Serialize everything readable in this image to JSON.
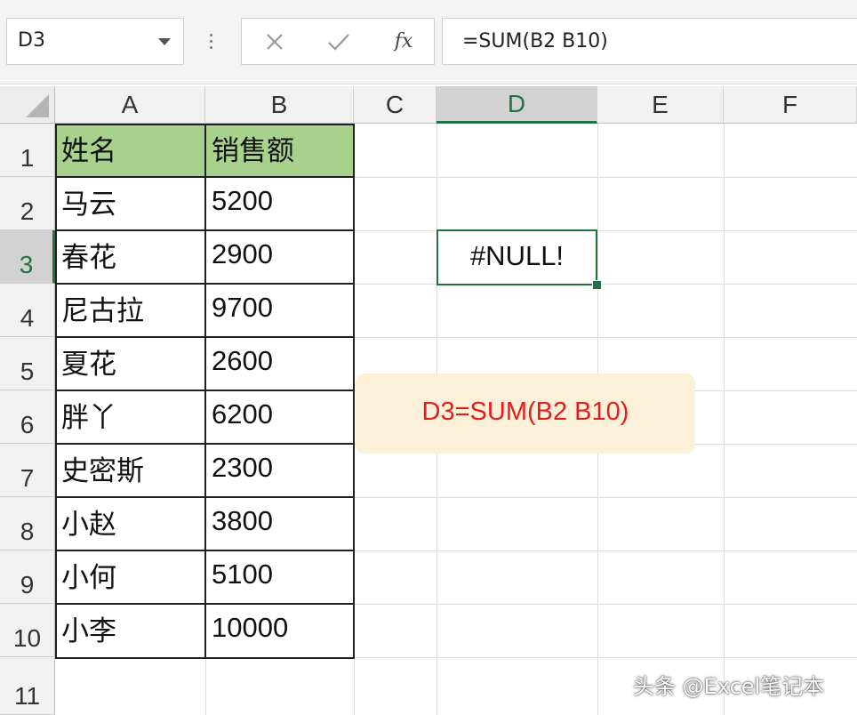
{
  "formula_bar": {
    "name_box": "D3",
    "function_icon": "fx",
    "formula": "=SUM(B2 B10)"
  },
  "columns": [
    "A",
    "B",
    "C",
    "D",
    "E",
    "F"
  ],
  "rows": [
    "1",
    "2",
    "3",
    "4",
    "5",
    "6",
    "7",
    "8",
    "9",
    "10",
    "11"
  ],
  "table": {
    "headers": [
      "姓名",
      "销售额"
    ],
    "rows": [
      [
        "马云",
        "5200"
      ],
      [
        "春花",
        "2900"
      ],
      [
        "尼古拉",
        "9700"
      ],
      [
        "夏花",
        "2600"
      ],
      [
        "胖丫",
        "6200"
      ],
      [
        "史密斯",
        "2300"
      ],
      [
        "小赵",
        "3800"
      ],
      [
        "小何",
        "5100"
      ],
      [
        "小李",
        "10000"
      ]
    ]
  },
  "active_cell": {
    "ref": "D3",
    "value": "#NULL!"
  },
  "annotation": "D3=SUM(B2 B10)",
  "watermark": "头条 @Excel笔记本",
  "colors": {
    "header_fill": "#a9d18e",
    "selection": "#217346",
    "annotation_text": "#e02020",
    "annotation_bg": "#fdf0d9"
  }
}
